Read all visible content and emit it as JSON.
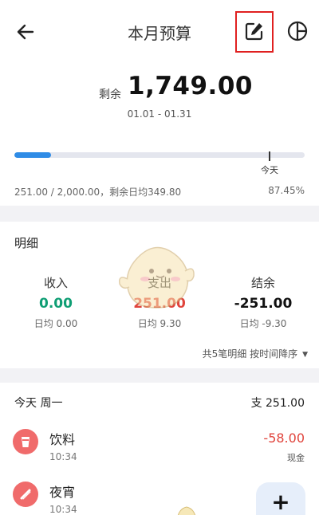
{
  "header": {
    "title": "本月预算",
    "back_icon": "arrow-left-icon",
    "edit_icon": "edit-icon",
    "chart_icon": "pie-chart-icon"
  },
  "summary": {
    "remaining_label": "剩余",
    "remaining_amount": "1,749.00",
    "date_range": "01.01 - 01.31",
    "progress_fraction": 0.1255,
    "today_label": "今天",
    "usage_text": "251.00 / 2,000.00，剩余日均349.80",
    "usage_percent": "87.45%"
  },
  "detail": {
    "title": "明细",
    "income": {
      "label": "收入",
      "value": "0.00",
      "avg": "日均 0.00"
    },
    "expense": {
      "label": "支出",
      "value": "251.00",
      "avg": "日均 9.30"
    },
    "balance": {
      "label": "结余",
      "value": "-251.00",
      "avg": "日均 -9.30"
    },
    "sort_text": "共5笔明细 按时间降序"
  },
  "list": {
    "day_label": "今天 周一",
    "day_total": "支 251.00",
    "items": [
      {
        "name": "饮料",
        "time": "10:34",
        "amount": "-58.00",
        "account": "现金",
        "icon": "drink-cup-icon"
      },
      {
        "name": "夜宵",
        "time": "10:34",
        "icon": "late-snack-icon"
      }
    ]
  },
  "fab": {
    "label": "+"
  },
  "colors": {
    "accent_blue": "#2f8ce6",
    "income_green": "#0f9e74",
    "expense_red": "#e0443c",
    "highlight_red": "#e02020"
  }
}
